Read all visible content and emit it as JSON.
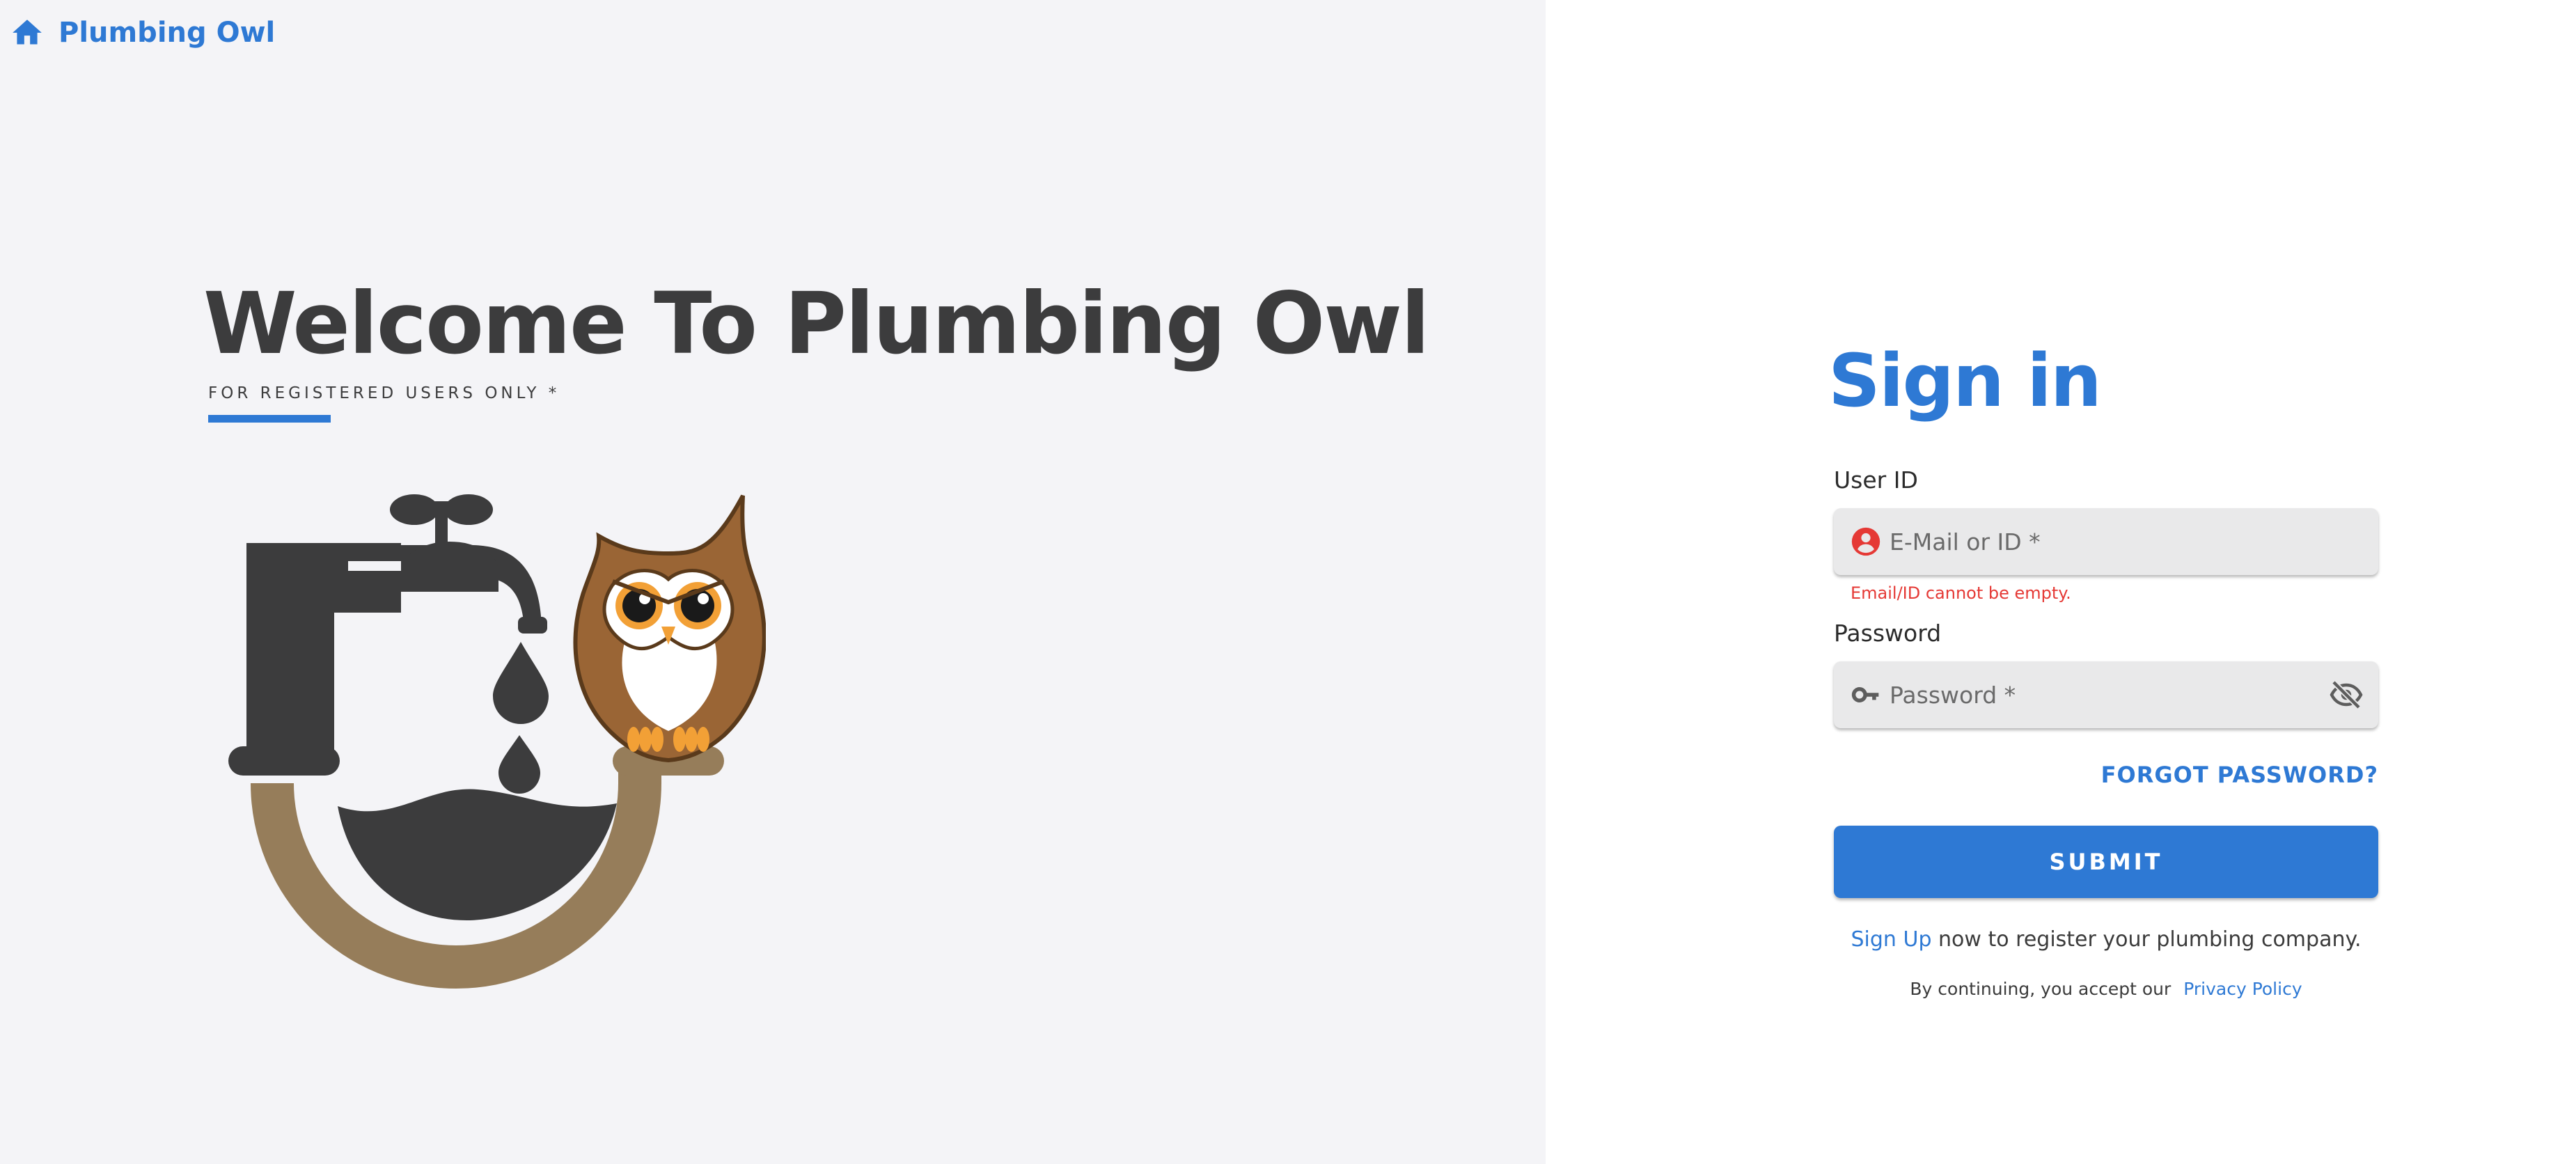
{
  "brand": {
    "name": "Plumbing Owl",
    "icon": "home-icon",
    "color": "#2e79d4"
  },
  "hero": {
    "title": "Welcome To Plumbing Owl",
    "subtitle": "FOR REGISTERED USERS ONLY *",
    "illustration": "faucet-owl-logo"
  },
  "signin": {
    "title": "Sign in",
    "user_id": {
      "label": "User ID",
      "placeholder": "E-Mail or ID *",
      "value": "",
      "icon": "account-circle-icon",
      "error": "Email/ID cannot be empty."
    },
    "password": {
      "label": "Password",
      "placeholder": "Password *",
      "value": "",
      "icon": "key-icon",
      "toggle_icon": "eye-off-icon"
    },
    "forgot_password": "FORGOT PASSWORD?",
    "submit": "SUBMIT",
    "signup": {
      "link": "Sign Up",
      "text": "now to register your plumbing company."
    },
    "policy": {
      "text": "By continuing, you accept our",
      "link": "Privacy Policy"
    }
  },
  "colors": {
    "accent": "#2e79d4",
    "error": "#e53935",
    "heading": "#3c3c3d",
    "left_background": "#f4f4f7",
    "input_background": "#e9e9ea",
    "pipe": "#967d5a",
    "faucet": "#3c3c3d",
    "owl_body": "#9a6535"
  }
}
